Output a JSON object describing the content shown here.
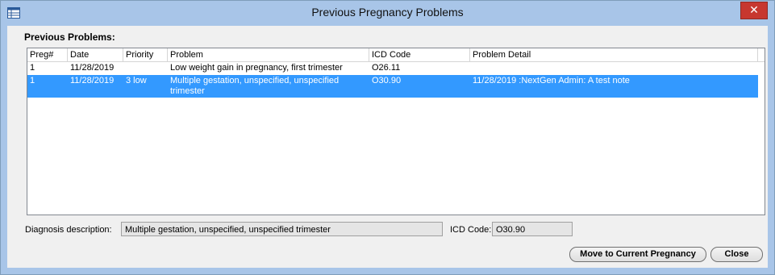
{
  "window": {
    "title": "Previous Pregnancy Problems",
    "close_glyph": "✕"
  },
  "section": {
    "label": "Previous Problems:"
  },
  "table": {
    "columns": [
      "Preg#",
      "Date",
      "Priority",
      "Problem",
      "ICD Code",
      "Problem Detail"
    ],
    "rows": [
      {
        "preg": "1",
        "date": "11/28/2019",
        "priority": "",
        "problem": "Low weight gain in pregnancy, first trimester",
        "icd": "O26.11",
        "detail": "",
        "selected": false
      },
      {
        "preg": "1",
        "date": "11/28/2019",
        "priority": "3 low",
        "problem": "Multiple gestation, unspecified, unspecified trimester",
        "icd": "O30.90",
        "detail": "11/28/2019 :NextGen Admin: A test note",
        "selected": true
      }
    ]
  },
  "footer": {
    "diagnosis_label": "Diagnosis description:",
    "diagnosis_value": "Multiple gestation, unspecified, unspecified trimester",
    "icd_label": "ICD Code:",
    "icd_value": "O30.90",
    "move_button": "Move to Current Pregnancy",
    "close_button": "Close"
  },
  "colors": {
    "titlebar": "#a8c5e8",
    "selection": "#3399ff",
    "close_button": "#c7372f"
  }
}
